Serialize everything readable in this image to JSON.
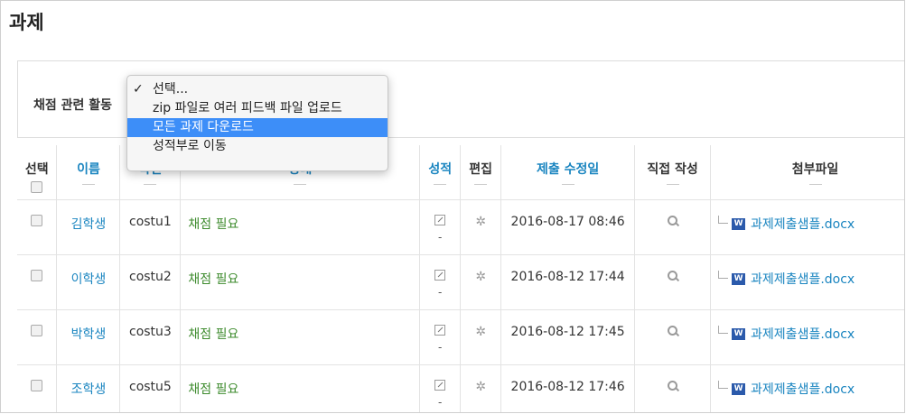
{
  "page": {
    "title": "과제"
  },
  "grading": {
    "label": "채점 관련 활동"
  },
  "dropdown": {
    "options": [
      {
        "label": "선택...",
        "checked": true
      },
      {
        "label": "zip 파일로 여러 피드백 파일 업로드"
      },
      {
        "label": "모든 과제 다운로드",
        "highlighted": true
      },
      {
        "label": "성적부로 이동"
      }
    ]
  },
  "table": {
    "headers": {
      "select": "선택",
      "name": "이름",
      "id": "학번",
      "status": "상태",
      "grade": "성적",
      "edit": "편집",
      "modified": "제출 수정일",
      "direct": "직접 작성",
      "attachment": "첨부파일"
    },
    "rows": [
      {
        "name": "김학생",
        "id": "costu1",
        "status": "채점 필요",
        "grade": "-",
        "modified": "2016-08-17 08:46",
        "file": "과제제출샘플.docx"
      },
      {
        "name": "이학생",
        "id": "costu2",
        "status": "채점 필요",
        "grade": "-",
        "modified": "2016-08-12 17:44",
        "file": "과제제출샘플.docx"
      },
      {
        "name": "박학생",
        "id": "costu3",
        "status": "채점 필요",
        "grade": "-",
        "modified": "2016-08-12 17:45",
        "file": "과제제출샘플.docx"
      },
      {
        "name": "조학생",
        "id": "costu5",
        "status": "채점 필요",
        "grade": "-",
        "modified": "2016-08-12 17:46",
        "file": "과제제출샘플.docx"
      }
    ]
  },
  "icons": {
    "doc": "word-doc-icon",
    "edit": "edit-icon",
    "settings": "gear-icon",
    "search": "search-icon"
  },
  "colors": {
    "link": "#1a85c0",
    "status": "#3d8b2d",
    "highlight": "#3d8ef8"
  }
}
